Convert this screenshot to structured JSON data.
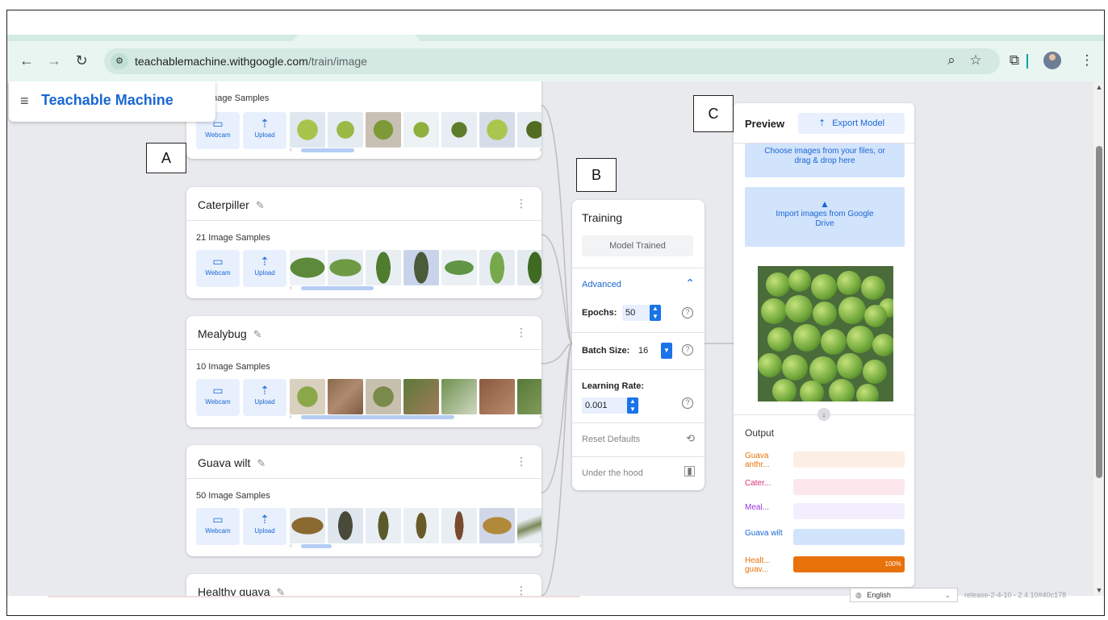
{
  "browser": {
    "url_host": "teachablemachine.withgoogle.com",
    "url_path": "/train/image"
  },
  "app": {
    "title": "Teachable Machine"
  },
  "labels": {
    "a": "A",
    "b": "B",
    "c": "C"
  },
  "classes": [
    {
      "name": "",
      "count": "Image Samples",
      "webcam": "Webcam",
      "upload": "Upload"
    },
    {
      "name": "Caterpiller",
      "count": "21 Image Samples",
      "webcam": "Webcam",
      "upload": "Upload"
    },
    {
      "name": "Mealybug",
      "count": "10 Image Samples",
      "webcam": "Webcam",
      "upload": "Upload"
    },
    {
      "name": "Guava wilt",
      "count": "50 Image Samples",
      "webcam": "Webcam",
      "upload": "Upload"
    },
    {
      "name": "Healthy guava"
    }
  ],
  "training": {
    "title": "Training",
    "status": "Model Trained",
    "advanced": "Advanced",
    "epochs_label": "Epochs:",
    "epochs_value": "50",
    "batch_label": "Batch Size:",
    "batch_value": "16",
    "lr_label": "Learning Rate:",
    "lr_value": "0.001",
    "reset": "Reset Defaults",
    "hood": "Under the hood"
  },
  "preview": {
    "title": "Preview",
    "export": "Export Model",
    "choose": "Choose images from your files, or drag & drop here",
    "drive": "Import images from Google Drive",
    "output_label": "Output",
    "outputs": [
      {
        "name": "Guava anthr...",
        "value": 0,
        "color": "#e8710a",
        "bg": "#fdeee3"
      },
      {
        "name": "Cater...",
        "value": 0,
        "color": "#d93072",
        "bg": "#fce8ec"
      },
      {
        "name": "Meal...",
        "value": 0,
        "color": "#9334e6",
        "bg": "#f3eefd"
      },
      {
        "name": "Guava wilt",
        "value": 0,
        "color": "#1967d2",
        "bg": "#d2e3fc"
      },
      {
        "name": "Healt... guav...",
        "value": 100,
        "pct": "100%",
        "color": "#e8710a",
        "bg": "#fdeee3"
      }
    ]
  },
  "footer": {
    "language": "English",
    "release": "release-2-4-10 - 2.4.10#40c178"
  }
}
